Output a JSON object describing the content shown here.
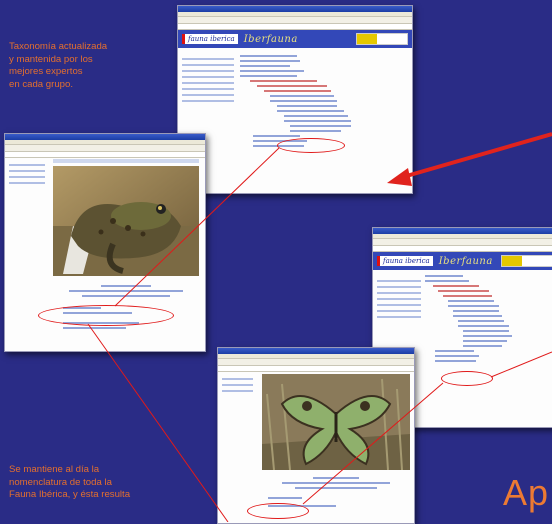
{
  "captions": {
    "top": [
      "Taxonomía actualizada",
      "y mantenida por los",
      "mejores expertos",
      "en cada grupo."
    ],
    "bottom": [
      "Se mantiene al día la",
      "nomenclatura de toda la",
      "Fauna Ibérica, y ésta resulta"
    ]
  },
  "site": {
    "logo": "fauna iberica",
    "brand": "Iberfauna",
    "brand_short": "Iberfauna"
  },
  "headline_fragment": "Ap",
  "colors": {
    "background": "#2a2c86",
    "caption": "#e46f2e",
    "highlight": "#e01a1a",
    "banner": "#3348b8"
  }
}
